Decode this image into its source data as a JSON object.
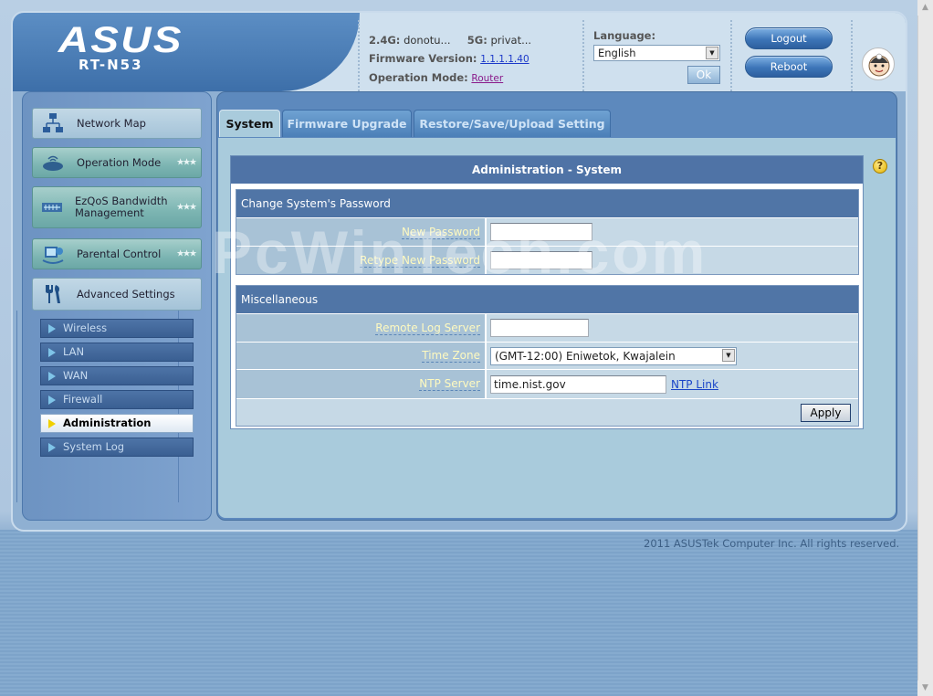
{
  "header": {
    "brand": "ASUS",
    "model": "RT-N53",
    "status": {
      "band24_label": "2.4G:",
      "band24_value": "donotu...",
      "band5_label": "5G:",
      "band5_value": "privat...",
      "firmware_label": "Firmware Version:",
      "firmware_value": "1.1.1.1.40",
      "mode_label": "Operation Mode:",
      "mode_value": "Router"
    },
    "language_label": "Language:",
    "language_value": "English",
    "ok_label": "Ok",
    "logout_label": "Logout",
    "reboot_label": "Reboot"
  },
  "sidebar": {
    "items": [
      {
        "label": "Network Map",
        "icon": "network-map-icon"
      },
      {
        "label": "Operation Mode",
        "icon": "router-icon"
      },
      {
        "label": "EzQoS Bandwidth Management",
        "icon": "qos-icon"
      },
      {
        "label": "Parental Control",
        "icon": "parental-control-icon"
      },
      {
        "label": "Advanced Settings",
        "icon": "tools-icon"
      }
    ],
    "sub_items": [
      "Wireless",
      "LAN",
      "WAN",
      "Firewall",
      "Administration",
      "System Log"
    ]
  },
  "tabs": [
    "System",
    "Firmware Upgrade",
    "Restore/Save/Upload Setting"
  ],
  "panel": {
    "title": "Administration - System",
    "password_section": {
      "heading": "Change System's Password",
      "new_password_label": "New Password",
      "retype_password_label": "Retype New Password"
    },
    "misc_section": {
      "heading": "Miscellaneous",
      "remote_log_label": "Remote Log Server",
      "remote_log_value": "",
      "time_zone_label": "Time Zone",
      "time_zone_value": "(GMT-12:00) Eniwetok, Kwajalein",
      "ntp_label": "NTP Server",
      "ntp_value": "time.nist.gov",
      "ntp_link": "NTP Link"
    },
    "apply_label": "Apply"
  },
  "footer": "2011 ASUSTek Computer Inc. All rights reserved.",
  "watermark": "PcWinTech.com"
}
